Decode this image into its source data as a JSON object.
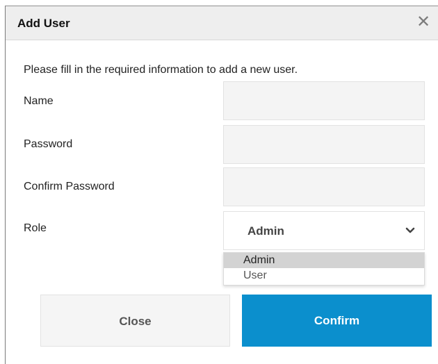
{
  "dialog": {
    "title": "Add User",
    "close_icon": "close-icon",
    "intro": "Please fill in the required information to add a new user."
  },
  "form": {
    "name": {
      "label": "Name",
      "value": "",
      "placeholder": ""
    },
    "password": {
      "label": "Password",
      "value": "",
      "placeholder": ""
    },
    "confirm_password": {
      "label": "Confirm Password",
      "value": "",
      "placeholder": ""
    },
    "role": {
      "label": "Role",
      "selected": "Admin",
      "options": [
        "Admin",
        "User"
      ],
      "icon": "chevron-down-icon"
    }
  },
  "buttons": {
    "close_label": "Close",
    "confirm_label": "Confirm"
  },
  "colors": {
    "header_bg": "#eeeeee",
    "confirm_bg": "#0b8fcd",
    "field_bg": "#f4f4f4",
    "selected_option_bg": "#d3d3d3"
  }
}
